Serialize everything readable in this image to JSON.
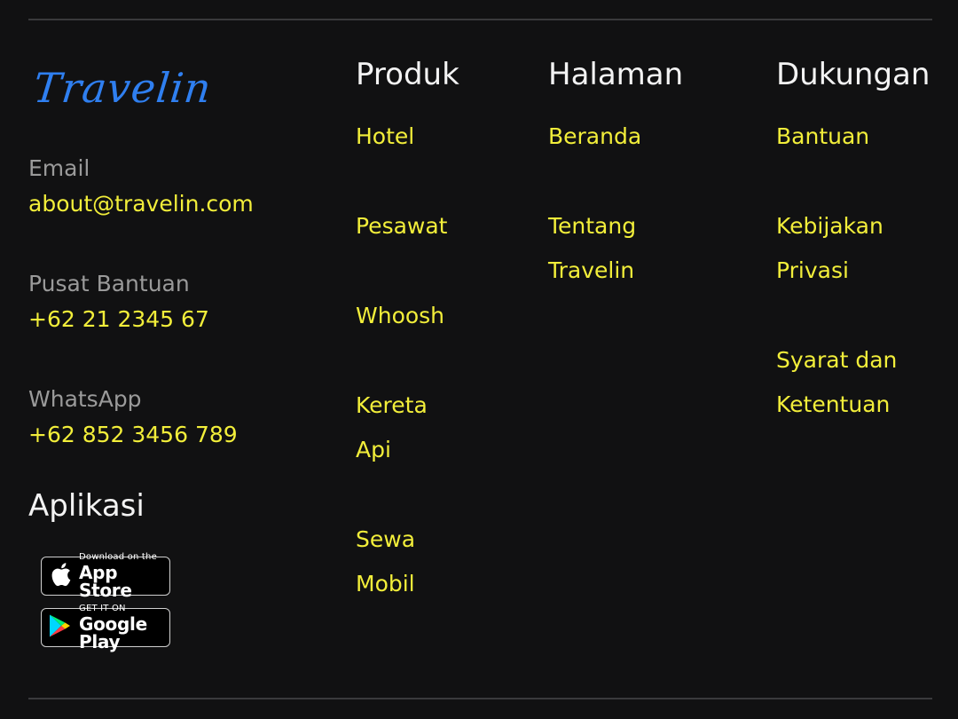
{
  "brand": {
    "logo_text": "Travelin",
    "logo_color": "#2f7ff0"
  },
  "contact": {
    "email_label": "Email",
    "email_value": "about@travelin.com",
    "help_label": "Pusat Bantuan",
    "help_value": "+62 21 2345 67",
    "whatsapp_label": "WhatsApp",
    "whatsapp_value": "+62 852 3456 789"
  },
  "apps": {
    "title": "Aplikasi",
    "app_store": {
      "small": "Download on the",
      "big": "App Store"
    },
    "google_play": {
      "small": "GET IT ON",
      "big": "Google Play"
    }
  },
  "columns": {
    "produk": {
      "title": "Produk",
      "items": [
        {
          "line1": "Hotel",
          "line2": ""
        },
        {
          "line1": "Pesawat",
          "line2": ""
        },
        {
          "line1": "Whoosh",
          "line2": ""
        },
        {
          "line1": "Kereta",
          "line2": "Api"
        },
        {
          "line1": "Sewa",
          "line2": "Mobil"
        }
      ]
    },
    "halaman": {
      "title": "Halaman",
      "items": [
        {
          "line1": "Beranda",
          "line2": ""
        },
        {
          "line1": "Tentang",
          "line2": "Travelin"
        }
      ]
    },
    "dukungan": {
      "title": "Dukungan",
      "items": [
        {
          "line1": "Bantuan",
          "line2": ""
        },
        {
          "line1": "Kebijakan",
          "line2": "Privasi"
        },
        {
          "line1": "Syarat dan",
          "line2": "Ketentuan"
        }
      ]
    }
  },
  "colors": {
    "background": "#111112",
    "accent": "#f2ee3a",
    "heading": "#f3f3f3",
    "muted": "#9a9a9a"
  }
}
